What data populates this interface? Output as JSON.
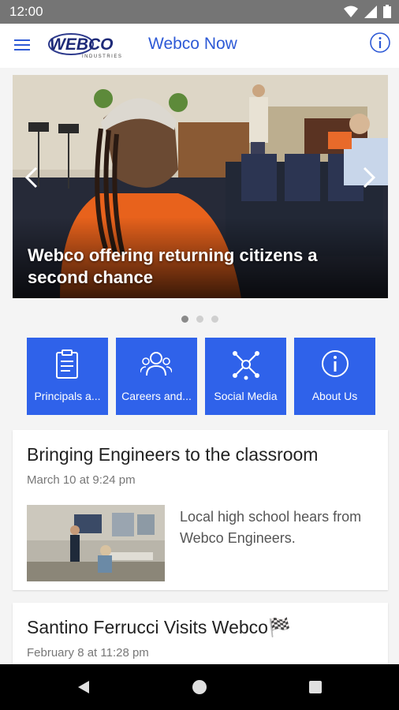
{
  "status_bar": {
    "time": "12:00"
  },
  "app_bar": {
    "logo_text": "WEBCO",
    "logo_subtext": "INDUSTRIES",
    "title": "Webco Now"
  },
  "carousel": {
    "caption": "Webco offering returning citizens a second chance",
    "slide_count": 3,
    "active_index": 0
  },
  "tiles": [
    {
      "label": "Principals a...",
      "icon": "clipboard-icon"
    },
    {
      "label": "Careers and...",
      "icon": "people-icon"
    },
    {
      "label": "Social Media",
      "icon": "network-icon"
    },
    {
      "label": "About Us",
      "icon": "info-icon"
    }
  ],
  "posts": [
    {
      "title": "Bringing Engineers to the classroom",
      "date": "March 10 at 9:24 pm",
      "excerpt": "Local high school hears from Webco Engineers."
    },
    {
      "title": "Santino Ferrucci Visits Webco🏁",
      "date": "February 8 at 11:28 pm"
    }
  ],
  "colors": {
    "accent": "#2f62ea",
    "title_blue": "#2e5ad6",
    "status_bar": "#757575",
    "nav_bar": "#000000"
  }
}
